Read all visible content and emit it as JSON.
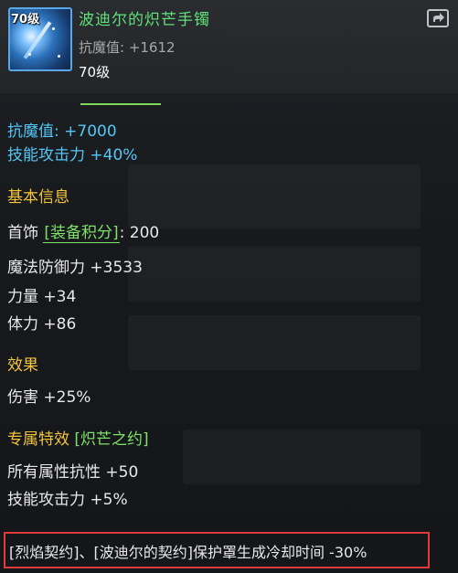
{
  "item": {
    "level_tag": "70级",
    "name": "波迪尔的炽芒手镯",
    "resist_label": "抗魔值: +1612",
    "level": "70级"
  },
  "bonus_stats": [
    "抗魔值: +7000",
    "技能攻击力 +40%"
  ],
  "basic_info": {
    "title": "基本信息",
    "slot": "首饰",
    "score_label": "[装备积分]",
    "score_value": ": 200",
    "stats": [
      "魔法防御力 +3533",
      "力量 +34",
      "体力 +86"
    ]
  },
  "effect": {
    "title": "效果",
    "lines": [
      "伤害 +25%"
    ]
  },
  "special": {
    "title": "专属特效",
    "tag": "[炽芒之约]",
    "lines": [
      "所有属性抗性 +50",
      "技能攻击力 +5%"
    ]
  },
  "highlight_text": "[烈焰契约]、[波迪尔的契约]保护罩生成冷却时间 -30%",
  "colors": {
    "name": "#5fe07a",
    "bonus": "#55c6f5",
    "section_title": "#f0c43c",
    "highlight_border": "#e03a3a"
  }
}
